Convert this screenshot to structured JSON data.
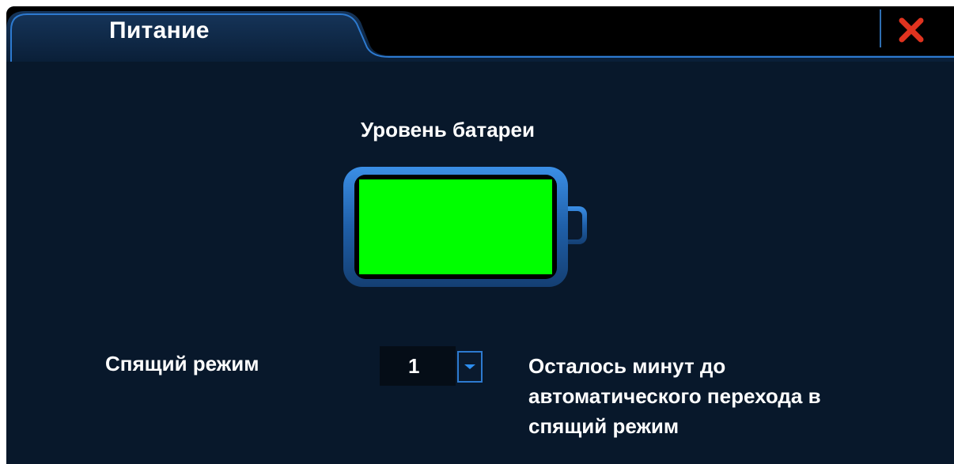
{
  "window": {
    "tab_title": "Питание"
  },
  "battery": {
    "title": "Уровень батареи",
    "level": 1.0,
    "fill_color": "#00ff00"
  },
  "sleep": {
    "label": "Спящий режим",
    "selected_value": "1",
    "description_lines": [
      "Осталось минут до",
      "автоматического перехода в",
      "спящий режим"
    ]
  },
  "icons": {
    "close": "close-icon",
    "dropdown": "chevron-down-icon"
  },
  "colors": {
    "background": "#08182b",
    "accent": "#2d7ad0",
    "close": "#e0331f"
  }
}
